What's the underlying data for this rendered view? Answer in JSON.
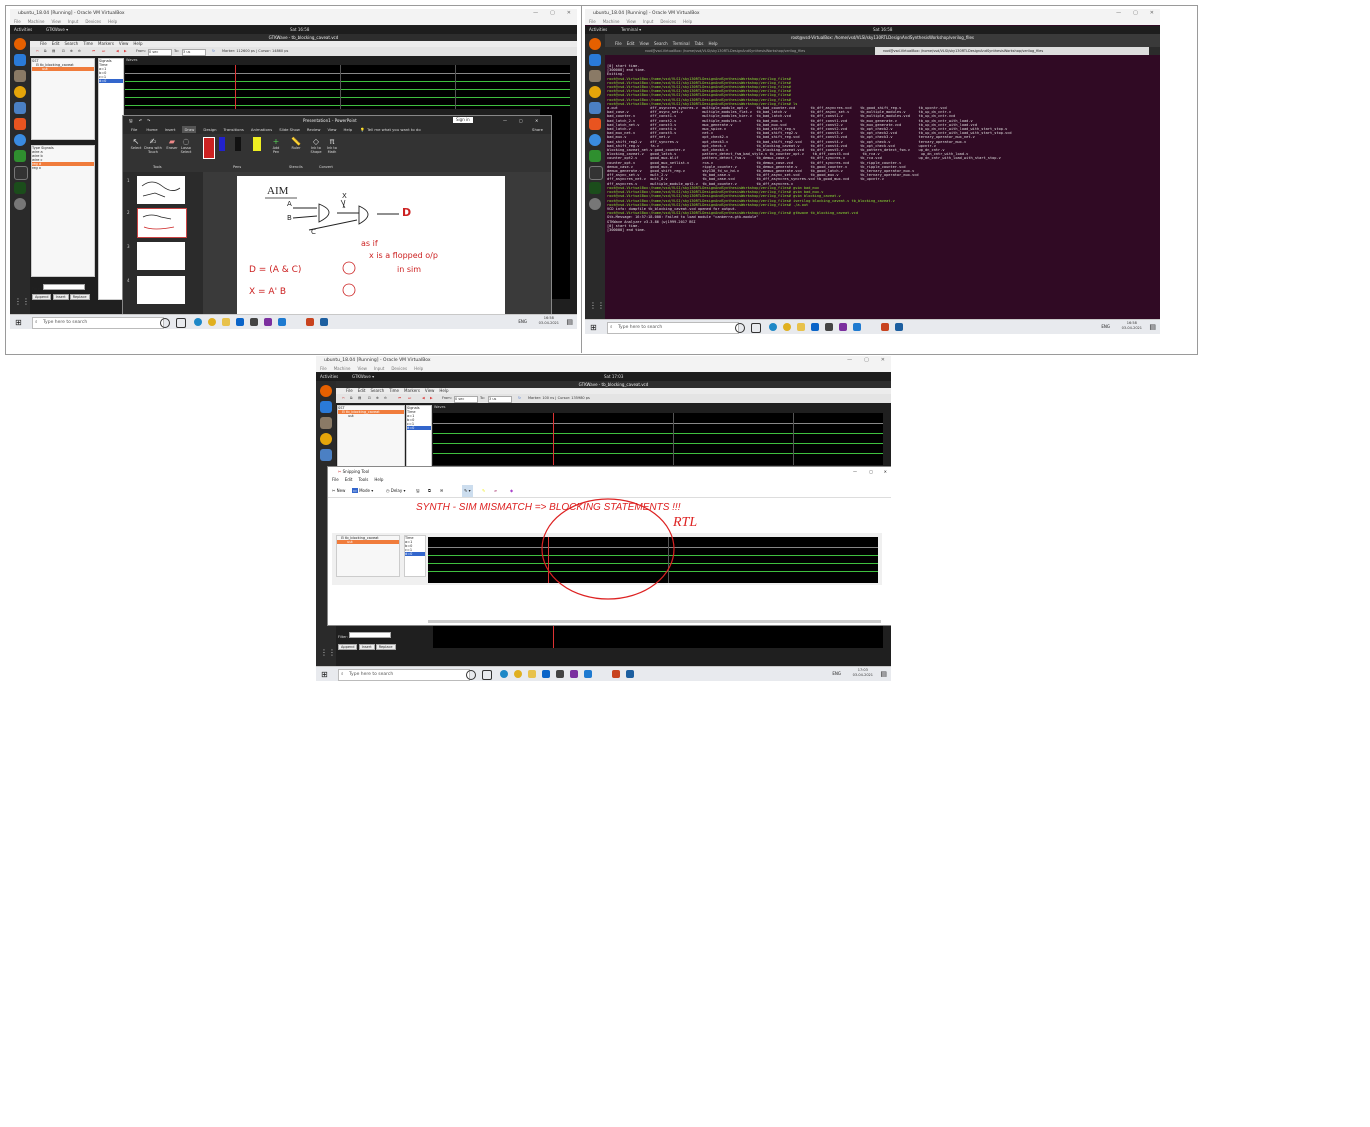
{
  "vm_title": "ubuntu_18.04 [Running] - Oracle VM VirtualBox",
  "vm_menu": [
    "File",
    "Machine",
    "View",
    "Input",
    "Devices",
    "Help"
  ],
  "ubuntu": {
    "activities": "Activities",
    "gtkwave_app": "GTKWave ▾",
    "terminal_app": "Terminal ▾",
    "clock_left": "Sat 16:58",
    "clock_right": "Sat 16:58",
    "clock_bottom": "Sat 17:03"
  },
  "gtkwave": {
    "title_left": "GTKWave - tb_blocking_caveat.vcd",
    "title_bottom": "GTKWave - tb_blocking_caveat.vcd",
    "menu": [
      "File",
      "Edit",
      "Search",
      "Time",
      "Markers",
      "View",
      "Help"
    ],
    "from_label": "From:",
    "from_value": "0 sec",
    "to_label": "To:",
    "to_value": "3 us",
    "marker_left": "Marker: 112600 ps | Cursor: 14860 ps",
    "marker_bottom": "Marker: 100 ns | Cursor: 135980 ps",
    "sst_label": "SST",
    "tree_item": "tb_blocking_caveat",
    "tree_child": "uut",
    "signals_header": "Signals",
    "waves_header": "Waves",
    "signals": [
      "Time",
      "a=1",
      "b=0",
      "c=1",
      "d=0"
    ],
    "type_header": "Type",
    "signals_col_header": "Signals",
    "declared": [
      {
        "type": "wire",
        "name": "a"
      },
      {
        "type": "wire",
        "name": "b"
      },
      {
        "type": "wire",
        "name": "c"
      },
      {
        "type": "reg",
        "name": "d"
      },
      {
        "type": "reg",
        "name": "x"
      }
    ],
    "filter_label": "Filter:",
    "buttons": [
      "Append",
      "Insert",
      "Replace"
    ]
  },
  "powerpoint": {
    "title": "Presentation1 - PowerPoint",
    "signin": "Sign in",
    "tabs": [
      "File",
      "Home",
      "Insert",
      "Draw",
      "Design",
      "Transitions",
      "Animations",
      "Slide Show",
      "Review",
      "View",
      "Help"
    ],
    "active_tab": "Draw",
    "tell_me": "Tell me what you want to do",
    "share": "Share",
    "tools": [
      "Select",
      "Draw with Touch",
      "Eraser",
      "Lasso Select",
      "Add Pen",
      "Ruler",
      "Ink to Shape",
      "Ink to Math"
    ],
    "groups": [
      "Tools",
      "Pens",
      "Stencils",
      "Convert"
    ],
    "slide_numbers": [
      "1",
      "2",
      "3",
      "4"
    ],
    "ink_text": [
      "AIM",
      "A",
      "B",
      "C",
      "X",
      "D",
      "D = (A & C)",
      "X = A' B",
      "as if",
      "x is a flopped o/p",
      "in sim"
    ]
  },
  "terminal": {
    "window_title": "root@vsd-VirtualBox: /home/vsd/VLSI/sky130RTLDesignAndSynthesisWorkshop/verilog_files",
    "tab1": "root@vsd-VirtualBox: /home/vsd/VLSI/sky130RTLDesignAndSynthesisWorkshop/verilog_files",
    "tab2": "root@vsd-VirtualBox: /home/vsd/VLSI/sky130RTLDesignAndSynthesisWorkshop/verilog_files",
    "menu": [
      "File",
      "Edit",
      "View",
      "Search",
      "Terminal",
      "Tabs",
      "Help"
    ],
    "lines": [
      "[0] start time.",
      "[300000] end time.",
      "Exiting.",
      "root@vsd-VirtualBox:/home/vsd/VLSI/sky130RTLDesignAndSynthesisWorkshop/verilog_files#",
      "root@vsd-VirtualBox:/home/vsd/VLSI/sky130RTLDesignAndSynthesisWorkshop/verilog_files#",
      "root@vsd-VirtualBox:/home/vsd/VLSI/sky130RTLDesignAndSynthesisWorkshop/verilog_files#",
      "root@vsd-VirtualBox:/home/vsd/VLSI/sky130RTLDesignAndSynthesisWorkshop/verilog_files#",
      "root@vsd-VirtualBox:/home/vsd/VLSI/sky130RTLDesignAndSynthesisWorkshop/verilog_files#",
      "root@vsd-VirtualBox:/home/vsd/VLSI/sky130RTLDesignAndSynthesisWorkshop/verilog_files#",
      "root@vsd-VirtualBox:/home/vsd/VLSI/sky130RTLDesignAndSynthesisWorkshop/verilog_files# ls",
      "a.out               dff_asyncres_syncres.v  multiple_module_opt.v    tb_bad_counter.vcd       tb_dff_asyncres.vcd    tb_good_shift_reg.v        tb_upcntr.vcd",
      "bad_case.v          dff_async_set.v         multiple_modules_flat.v  tb_bad_latch.v           tb_dff_async_set.v     tb_multiple_modules.v      tb_up_dn_cntr.v",
      "bad_counter.v       dff_const1.v            multiple_modules_hier.v  tb_bad_latch.vcd         tb_dff_const1.v        tb_multiple_modules.vcd    tb_up_dn_cntr.vcd",
      "bad_latch_2.v       dff_const2.v            multiple_modules.v       tb_bad_mux.v             tb_dff_const1.vcd      tb_mux_generate.v          tb_up_dn_cntr_with_load.v",
      "bad_latch_net.v     dff_const3.v            mux_generate.v           tb_bad_mux.vcd           tb_dff_const2.v        tb_mux_generate.vcd        tb_up_dn_cntr_with_load.vcd",
      "bad_latch.v         dff_const4.v            mux_spice.v              tb_bad_shift_reg.v       tb_dff_const2.vcd      tb_opt_check2.v            tb_up_dn_cntr_with_load_with_start_stop.v",
      "bad_mux_net.v       dff_const5.v            net.v                    tb_bad_shift_reg2.v      tb_dff_const3.v        tb_opt_check2.vcd          tb_up_dn_cntr_with_load_with_start_stop.vcd",
      "bad_mux.v           dff_net.v               opt_check2.v             tb_bad_shift_reg.vcd     tb_dff_const3.vcd      tb_opt_check3.v            ternary_operator_mux_net.v",
      "bad_shift_reg2.v    dff_syncres.v           opt_check3.v             tb_bad_shift_reg2.vcd    tb_dff_const4.v        tb_opt_check.v             ternary_operator_mux.v",
      "bad_shift_reg.v     fa.v                    opt_check.v              tb_blocking_caveat.v     tb_dff_const4.vcd      tb_opt_check.vcd           upcntr.v",
      "blocking_caveat_net.v good_counter.v        opt_check4.v             tb_blocking_caveat.vcd   tb_dff_const5.v        tb_pattern_detect_fsm.v    up_dn_cntr.v",
      "blocking_caveat.v   good_latch.v            pattern_detect_fsm_bad_style.v tb_counter_opt.v    tb_dff_const5.vcd      tb_rca.v                   up_dn_cntr_with_load.v",
      "counter_opt2.v      good_mux.blif           pattern_detect_fsm.v     tb_demux_case.v          tb_dff_syncres.v       tb_rca.vcd                 up_dn_cntr_with_load_with_start_stop.v",
      "counter_opt.v       good_mux_netlist.v      rca.v                    tb_demux_case.vcd        tb_dff_syncres.vcd     tb_ripple_counter.v",
      "demux_case.v        good_mux.v              ripple_counter.v         tb_demux_generate.v      tb_good_counter.v      tb_ripple_counter.vcd",
      "demux_generate.v    good_shift_reg.v        sky130_fd_sc_hd.v        tb_demux_generate.vcd    tb_good_latch.v        tb_ternary_operator_mux.v",
      "dff_async_set.v     mult_2.v                tb_bad_case.v            tb_dff_async_set.vcd     tb_good_mux.v          tb_ternary_operator_mux.vcd",
      "dff_asyncres_net.v  mult_8.v                tb_bad_case.vcd          tb_dff_asyncres_syncres.vcd tb_good_mux.vcd     tb_upcntr.v",
      "dff_asyncres.v      multiple_module_opt2.v  tb_bad_counter.v         tb_dff_asyncres.v",
      "root@vsd-VirtualBox:/home/vsd/VLSI/sky130RTLDesignAndSynthesisWorkshop/verilog_files# gvim bad_mux",
      "root@vsd-VirtualBox:/home/vsd/VLSI/sky130RTLDesignAndSynthesisWorkshop/verilog_files# gvim bad_mux.v",
      "root@vsd-VirtualBox:/home/vsd/VLSI/sky130RTLDesignAndSynthesisWorkshop/verilog_files# gvim blocking_caveat.v",
      "root@vsd-VirtualBox:/home/vsd/VLSI/sky130RTLDesignAndSynthesisWorkshop/verilog_files# iverilog blocking_caveat.v tb_blocking_caveat.v",
      "root@vsd-VirtualBox:/home/vsd/VLSI/sky130RTLDesignAndSynthesisWorkshop/verilog_files# ./a.out",
      "VCD info: dumpfile tb_blocking_caveat.vcd opened for output.",
      "root@vsd-VirtualBox:/home/vsd/VLSI/sky130RTLDesignAndSynthesisWorkshop/verilog_files# gtkwave tb_blocking_caveat.vcd",
      "Gtk-Message: 16:57:18.000: Failed to load module \"canberra-gtk-module\"",
      "",
      "GTKWave Analyzer v3.3.86 (w)1999-2017 BSI",
      "",
      "[0] start time.",
      "[300000] end time."
    ]
  },
  "snipping": {
    "title": "Snipping Tool",
    "menu": [
      "File",
      "Edit",
      "Tools",
      "Help"
    ],
    "new": "New",
    "mode": "Mode",
    "delay": "Delay",
    "annotation": "SYNTH - SIM MISMATCH => BLOCKING STATEMENTS !!!",
    "annotation2": "RTL"
  },
  "windows": {
    "search_placeholder": "Type here to search",
    "lang": "ENG",
    "time_left": "16:58",
    "date_left": "03-04-2021",
    "time_right": "16:58",
    "date_right": "03-04-2021",
    "time_bottom": "17:03",
    "date_bottom": "03-04-2021",
    "night_off": "Night Off"
  },
  "colors": {
    "gtk_select": "#f07c3c",
    "wave_green": "#3fbf3f",
    "terminal_bg": "#300a24",
    "ink_red": "#d22222"
  }
}
